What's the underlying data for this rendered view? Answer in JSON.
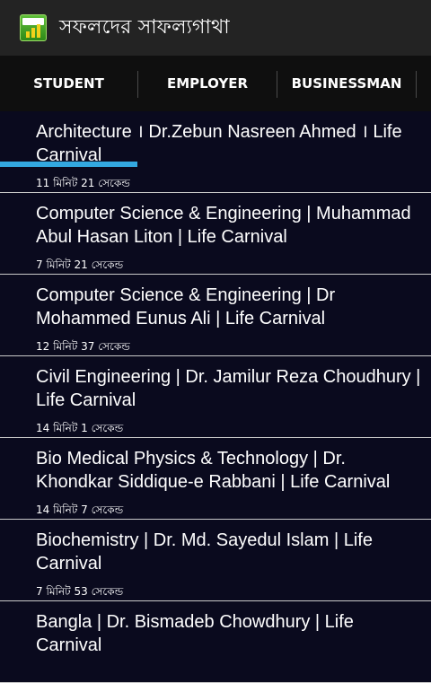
{
  "app": {
    "title": "সফলদের সাফল্যগাথা",
    "icon": "success-stories-app-icon"
  },
  "tabs": [
    {
      "label": "STUDENT",
      "selected": true
    },
    {
      "label": "EMPLOYER",
      "selected": false
    },
    {
      "label": "BUSINESSMAN",
      "selected": false
    }
  ],
  "colors": {
    "accent": "#33a8e0",
    "background": "#0a0a1e",
    "action_bar": "#232323",
    "tab_bar": "#0f0f0f",
    "divider": "#c9c9c9"
  },
  "items": [
    {
      "title": "Architecture । Dr.Zebun Nasreen Ahmed । Life Carnival",
      "duration": "11 মিনিট 21 সেকেন্ড"
    },
    {
      "title": "Computer Science & Engineering | Muhammad Abul Hasan Liton | Life Carnival",
      "duration": "7 মিনিট 21 সেকেন্ড"
    },
    {
      "title": "Computer Science & Engineering | Dr Mohammed Eunus Ali | Life Carnival",
      "duration": "12 মিনিট 37 সেকেন্ড"
    },
    {
      "title": "Civil Engineering | Dr. Jamilur Reza Choudhury | Life Carnival",
      "duration": "14 মিনিট 1 সেকেন্ড"
    },
    {
      "title": "Bio Medical Physics & Technology | Dr. Khondkar Siddique-e Rabbani | Life Carnival",
      "duration": "14 মিনিট 7 সেকেন্ড"
    },
    {
      "title": "Biochemistry | Dr. Md. Sayedul Islam | Life Carnival",
      "duration": "7 মিনিট 53 সেকেন্ড"
    },
    {
      "title": "Bangla | Dr. Bismadeb Chowdhury | Life Carnival",
      "duration": ""
    }
  ]
}
